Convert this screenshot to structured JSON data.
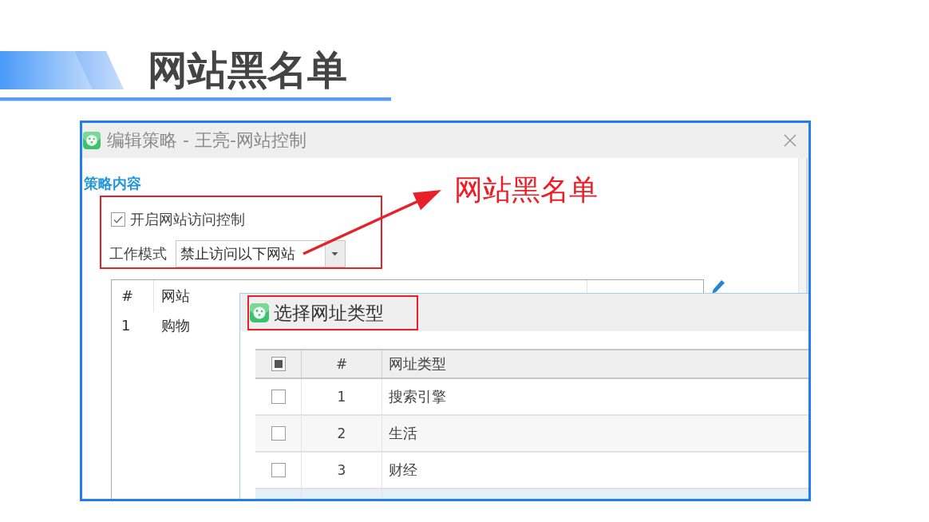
{
  "slide": {
    "title": "网站黑名单"
  },
  "screenshot": {
    "window": {
      "title": "编辑策略 - 王亮-网站控制"
    },
    "section_title": "策略内容",
    "settings": {
      "highlighted": true,
      "access_control": {
        "label": "开启网站访问控制",
        "checked": true
      },
      "work_mode": {
        "label": "工作模式",
        "value": "禁止访问以下网站"
      }
    },
    "annotation": {
      "text": "网站黑名单"
    },
    "websites_table": {
      "columns": [
        "#",
        "网站"
      ],
      "rows": [
        {
          "number": "1",
          "website": "购物"
        }
      ]
    },
    "dialog": {
      "title": "选择网址类型",
      "title_highlighted": true,
      "table": {
        "header_checkbox": {
          "indeterminate": true
        },
        "columns": [
          "#",
          "网址类型"
        ],
        "rows": [
          {
            "checked": false,
            "number": "1",
            "type": "搜索引擎",
            "selected": false
          },
          {
            "checked": false,
            "number": "2",
            "type": "生活",
            "selected": false
          },
          {
            "checked": false,
            "number": "3",
            "type": "财经",
            "selected": false
          },
          {
            "selected": true
          }
        ]
      }
    }
  }
}
